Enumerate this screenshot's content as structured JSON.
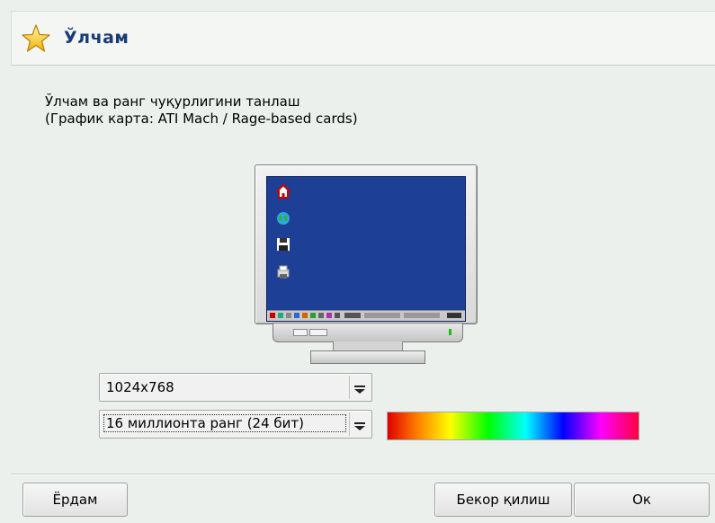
{
  "header": {
    "title": "Ўлчам",
    "icon": "star-icon"
  },
  "intro": {
    "line1": "Ўлчам ва ранг чуқурлигини танлаш",
    "line2": "(График карта: ATI Mach / Rage-based cards)"
  },
  "preview": {
    "desktop_icons": [
      "home-icon",
      "globe-icon",
      "floppy-icon",
      "printer-icon"
    ],
    "screen_color": "#1e3f96"
  },
  "resolution": {
    "selected": "1024x768"
  },
  "color_depth": {
    "selected": "16 миллионта ранг (24 бит)"
  },
  "buttons": {
    "help": "Ёрдам",
    "cancel": "Бекор қилиш",
    "ok": "Ок"
  }
}
